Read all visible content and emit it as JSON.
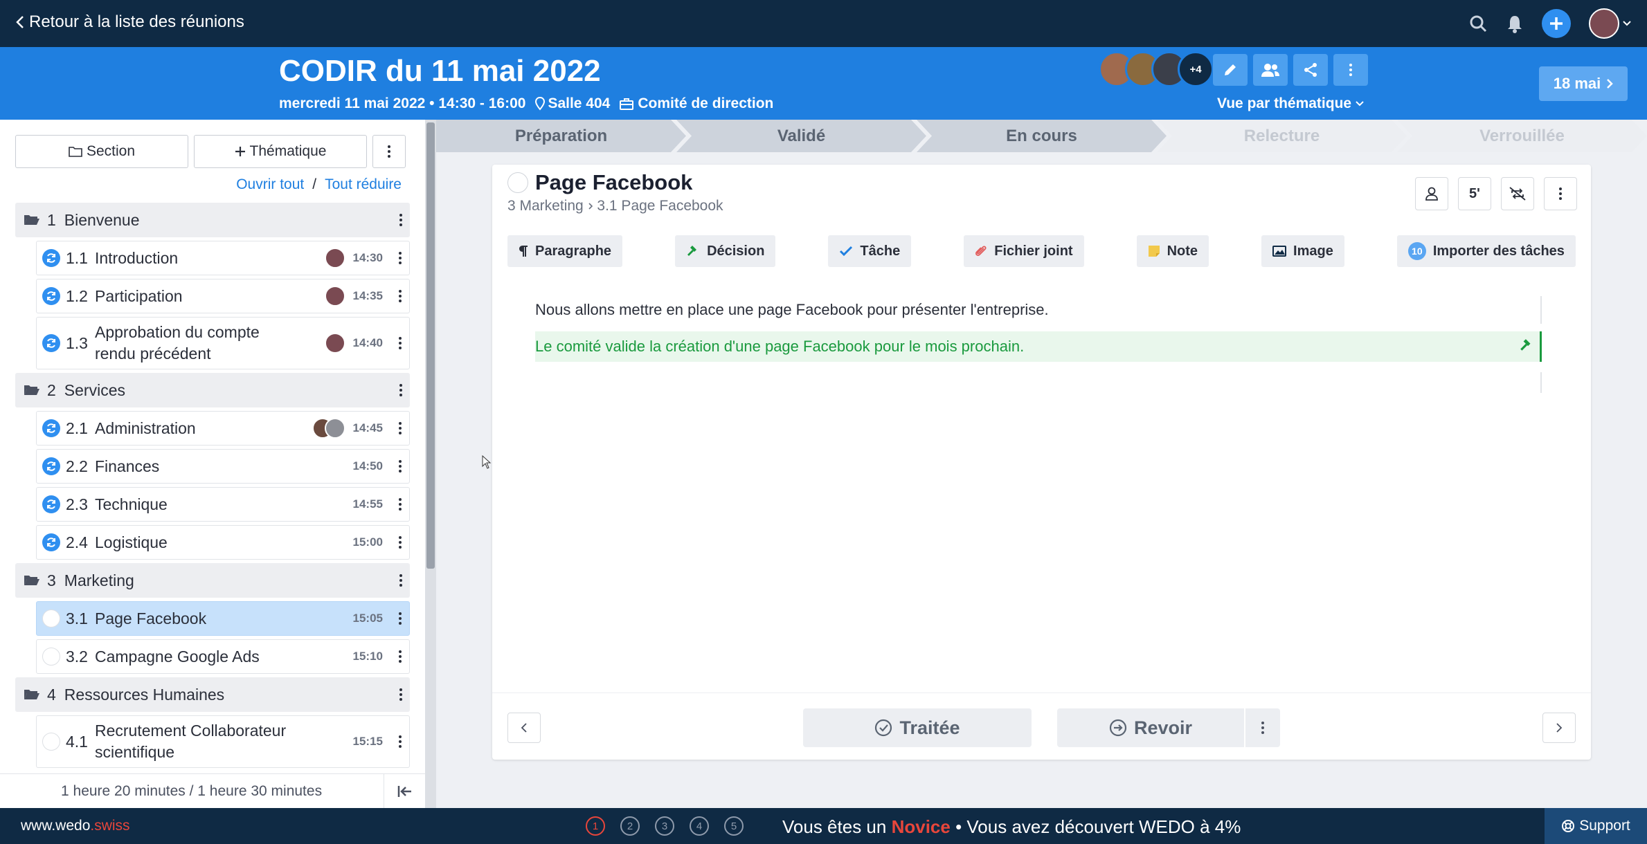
{
  "topbar": {
    "back_label": "Retour à la liste des réunions",
    "icons": [
      "search-icon",
      "bell-icon",
      "plus-icon",
      "user-avatar"
    ]
  },
  "meeting": {
    "title": "CODIR du 11 mai 2022",
    "date_time": "mercredi 11 mai 2022 • 14:30 - 16:00",
    "room": "Salle 404",
    "committee": "Comité de direction",
    "participants_more": "+4",
    "view_mode": "Vue par thématique",
    "next_date": "18 mai"
  },
  "sidebar": {
    "section_button": "Section",
    "theme_button": "Thématique",
    "open_all": "Ouvrir tout",
    "separator": "/",
    "collapse_all": "Tout réduire",
    "sections": [
      {
        "num": "1",
        "label": "Bienvenue",
        "items": [
          {
            "num": "1.1",
            "label": "Introduction",
            "time": "14:30"
          },
          {
            "num": "1.2",
            "label": "Participation",
            "time": "14:35"
          },
          {
            "num": "1.3",
            "label": "Approbation du compte rendu précédent",
            "time": "14:40"
          }
        ]
      },
      {
        "num": "2",
        "label": "Services",
        "items": [
          {
            "num": "2.1",
            "label": "Administration",
            "time": "14:45"
          },
          {
            "num": "2.2",
            "label": "Finances",
            "time": "14:50"
          },
          {
            "num": "2.3",
            "label": "Technique",
            "time": "14:55"
          },
          {
            "num": "2.4",
            "label": "Logistique",
            "time": "15:00"
          }
        ]
      },
      {
        "num": "3",
        "label": "Marketing",
        "items": [
          {
            "num": "3.1",
            "label": "Page Facebook",
            "time": "15:05"
          },
          {
            "num": "3.2",
            "label": "Campagne Google Ads",
            "time": "15:10"
          }
        ]
      },
      {
        "num": "4",
        "label": "Ressources Humaines",
        "items": [
          {
            "num": "4.1",
            "label": "Recrutement Collaborateur scientifique",
            "time": "15:15"
          }
        ]
      }
    ],
    "duration": "1 heure 20 minutes / 1 heure 30 minutes"
  },
  "steps": [
    "Préparation",
    "Validé",
    "En cours",
    "Relecture",
    "Verrouillée"
  ],
  "topic": {
    "title": "Page Facebook",
    "breadcrumb_parent": "3 Marketing",
    "breadcrumb_current": "3.1 Page Facebook",
    "duration": "5'",
    "insert": {
      "paragraph": "Paragraphe",
      "decision": "Décision",
      "task": "Tâche",
      "attachment": "Fichier joint",
      "note": "Note",
      "image": "Image",
      "import_count": "10",
      "import_tasks": "Importer des tâches"
    },
    "paragraph_text": "Nous allons mettre en place une page Facebook pour présenter l'entreprise.",
    "decision_text": "Le comité valide la création d'une page Facebook pour le mois prochain.",
    "done_label": "Traitée",
    "review_label": "Revoir"
  },
  "footer": {
    "brand_main": "www.wedo",
    "brand_suffix": ".swiss",
    "steps": [
      "1",
      "2",
      "3",
      "4",
      "5"
    ],
    "novice_prefix": "Vous êtes un",
    "novice_level": "Novice",
    "novice_suffix": "• Vous avez découvert WEDO à 4%",
    "support": "Support"
  },
  "colors": {
    "primary": "#1f7fe0",
    "navy": "#0f2a44",
    "decision_green": "#1a9a3e",
    "accent_red": "#e8463b"
  }
}
